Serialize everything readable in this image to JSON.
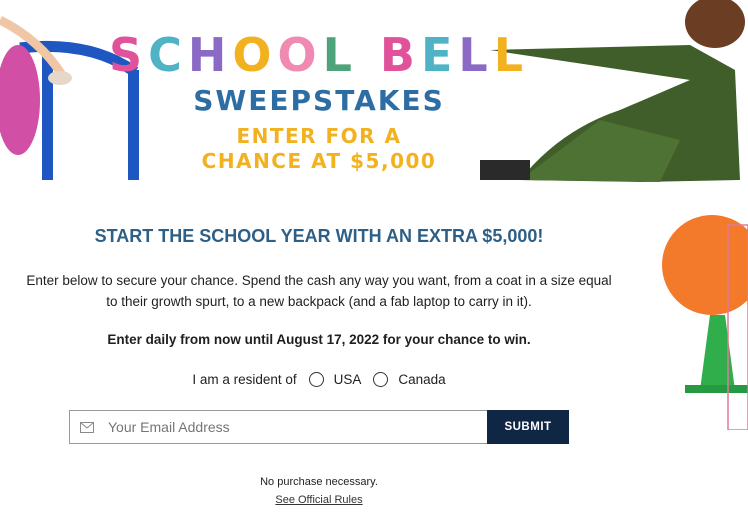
{
  "hero": {
    "title_letters": [
      {
        "ch": "S",
        "color": "#e0529a"
      },
      {
        "ch": "C",
        "color": "#4fb3c5"
      },
      {
        "ch": "H",
        "color": "#8a6ac5"
      },
      {
        "ch": "O",
        "color": "#f2b11f"
      },
      {
        "ch": "O",
        "color": "#f08ab3"
      },
      {
        "ch": "L",
        "color": "#4fa37a"
      },
      {
        "ch": " ",
        "color": "#000"
      },
      {
        "ch": "B",
        "color": "#e0529a"
      },
      {
        "ch": "E",
        "color": "#4fb3c5"
      },
      {
        "ch": "L",
        "color": "#8a6ac5"
      },
      {
        "ch": "L",
        "color": "#f2b11f"
      }
    ],
    "subtitle": "SWEEPSTAKES",
    "tagline_1": "ENTER FOR A",
    "tagline_2": "CHANCE AT $5,000"
  },
  "headline": "START THE SCHOOL YEAR WITH AN EXTRA $5,000!",
  "description": "Enter below to secure your chance. Spend the cash any way you want, from a coat in a size equal to their growth spurt, to a new backpack (and a fab laptop to carry in it).",
  "enter_text": "Enter daily from now until August 17, 2022 for your chance to win.",
  "resident": {
    "label": "I am a resident of",
    "options": [
      "USA",
      "Canada"
    ]
  },
  "form": {
    "email_placeholder": "Your Email Address",
    "submit_label": "SUBMIT"
  },
  "fine_print": "No purchase necessary.",
  "rules_link": "See Official Rules"
}
